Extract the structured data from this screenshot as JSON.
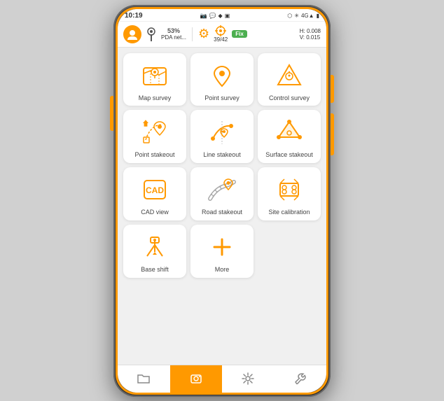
{
  "status_bar": {
    "time": "10:19",
    "battery": "▮",
    "signal": "4G▲",
    "icons": "📷 🔒 ♦ ▣"
  },
  "toolbar": {
    "percent": "53%",
    "pda_label": "PDA net...",
    "sat_count": "39/42",
    "fix_label": "Fix",
    "h_value": "H: 0.008",
    "v_value": "V: 0.015"
  },
  "grid_items": [
    {
      "id": "map-survey",
      "label": "Map survey"
    },
    {
      "id": "point-survey",
      "label": "Point survey"
    },
    {
      "id": "control-survey",
      "label": "Control survey"
    },
    {
      "id": "point-stakeout",
      "label": "Point stakeout"
    },
    {
      "id": "line-stakeout",
      "label": "Line stakeout"
    },
    {
      "id": "surface-stakeout",
      "label": "Surface stakeout"
    },
    {
      "id": "cad-view",
      "label": "CAD view"
    },
    {
      "id": "road-stakeout",
      "label": "Road stakeout"
    },
    {
      "id": "site-calibration",
      "label": "Site calibration"
    },
    {
      "id": "base-shift",
      "label": "Base shift"
    },
    {
      "id": "more",
      "label": "More"
    }
  ],
  "bottom_nav": [
    {
      "id": "folder",
      "label": "📁"
    },
    {
      "id": "survey",
      "label": "📷",
      "active": true
    },
    {
      "id": "settings",
      "label": "⚙"
    },
    {
      "id": "tools",
      "label": "🔧"
    }
  ]
}
